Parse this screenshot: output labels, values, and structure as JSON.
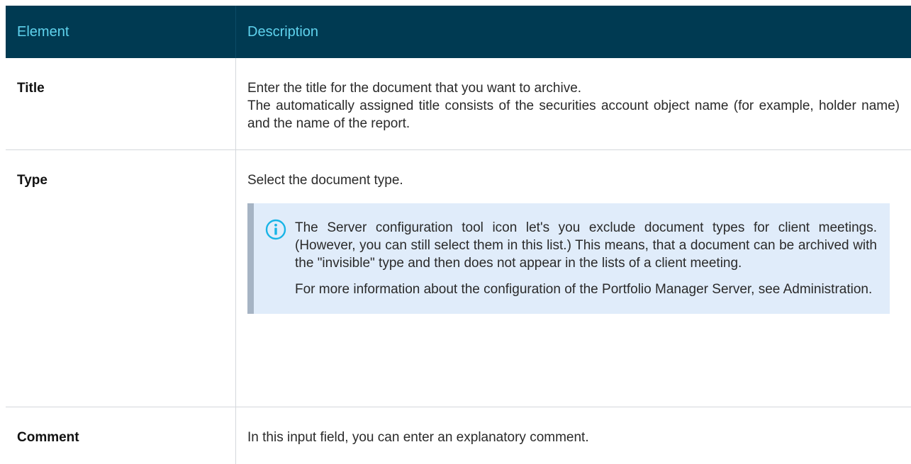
{
  "header": {
    "col1": "Element",
    "col2": "Description"
  },
  "rows": [
    {
      "element": "Title",
      "description_lines": [
        "Enter the title for the document that you want to archive.",
        "The automatically assigned title consists of the securities account object name (for example, holder name) and the name of the report."
      ]
    },
    {
      "element": "Type",
      "description": "Select the document type.",
      "note": {
        "icon": "info-icon",
        "paragraphs": [
          "The Server configuration tool icon let's you exclude document types for client meetings. (However, you can still select them in this list.) This means, that a document can be archived with the \"invisible\" type and then does not appear in the lists of a client meeting.",
          "For more information about the configuration of the Portfolio Manager Server, see Administration."
        ]
      }
    },
    {
      "element": "Comment",
      "description": "In this input field, you can enter an explanatory comment."
    }
  ],
  "colors": {
    "header_bg": "#003a52",
    "header_text": "#5fd3ee",
    "note_bg": "#e0ecfa",
    "note_border": "#a6b4c4",
    "info_icon": "#18b4e6"
  }
}
